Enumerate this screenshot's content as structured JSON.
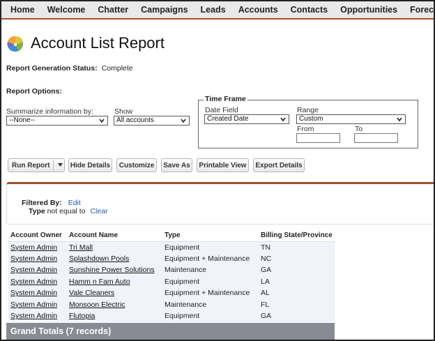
{
  "nav": {
    "items": [
      "Home",
      "Welcome",
      "Chatter",
      "Campaigns",
      "Leads",
      "Accounts",
      "Contacts",
      "Opportunities",
      "Forecasts"
    ]
  },
  "page": {
    "title": "Account List Report",
    "status_label": "Report Generation Status:",
    "status_value": "Complete",
    "options_label": "Report Options:"
  },
  "options": {
    "summarize_label": "Summarize information by:",
    "summarize_value": "--None--",
    "show_label": "Show",
    "show_value": "All accounts"
  },
  "timeframe": {
    "legend": "Time Frame",
    "date_field_label": "Date Field",
    "date_field_value": "Created Date",
    "range_label": "Range",
    "range_value": "Custom",
    "from_label": "From",
    "to_label": "To",
    "from_value": "",
    "to_value": ""
  },
  "buttons": {
    "run_report": "Run Report",
    "hide_details": "Hide Details",
    "customize": "Customize",
    "save_as": "Save As",
    "printable_view": "Printable View",
    "export_details": "Export Details"
  },
  "filter": {
    "filtered_by_label": "Filtered By:",
    "edit_link": "Edit",
    "field": "Type",
    "condition": "not equal to",
    "clear_link": "Clear"
  },
  "table": {
    "headers": [
      "Account Owner",
      "Account Name",
      "Type",
      "Billing State/Province"
    ],
    "rows": [
      [
        "System Admin",
        "Tri Mall",
        "Equipment",
        "TN"
      ],
      [
        "System Admin",
        "Splashdown Pools",
        "Equipment + Maintenance",
        "NC"
      ],
      [
        "System Admin",
        "Sunshine Power Solutions",
        "Maintenance",
        "GA"
      ],
      [
        "System Admin",
        "Hamm n Fam Auto",
        "Equipment",
        "LA"
      ],
      [
        "System Admin",
        "Vale Cleaners",
        "Equipment + Maintenance",
        "AL"
      ],
      [
        "System Admin",
        "Monsoon Electric",
        "Maintenance",
        "FL"
      ],
      [
        "System Admin",
        "Flutopia",
        "Equipment",
        "GA"
      ]
    ],
    "grand_totals": "Grand Totals (7 records)"
  },
  "colors": {
    "accent": "#a0522d",
    "link": "#1a5fa8",
    "grand_totals_bg": "#888b93",
    "row_bg": "#f0f4fa"
  },
  "icons": {
    "title_icon": "report-fan-icon",
    "dropdown": "chevron-down-icon"
  }
}
